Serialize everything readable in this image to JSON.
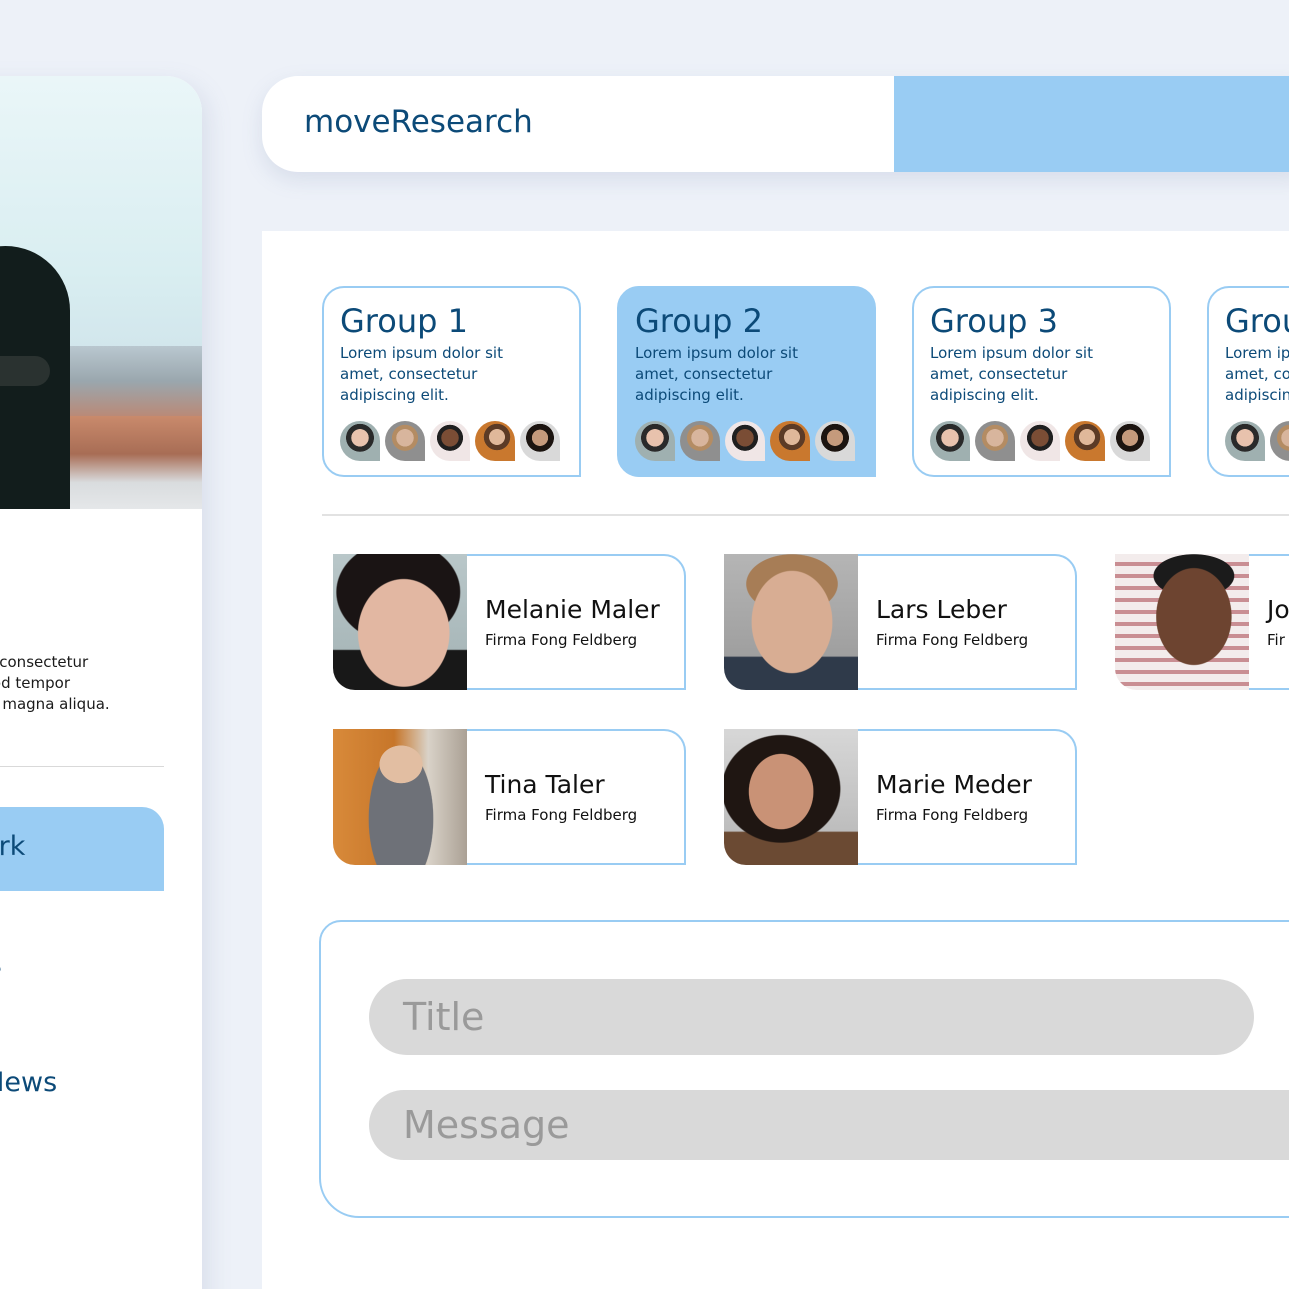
{
  "app": {
    "name": "moveResearch"
  },
  "colors": {
    "accent": "#99ccf3",
    "primary_text": "#0c4a78",
    "background": "#edf1f8"
  },
  "sidebar": {
    "description": "met, consectetur\nusmod tempor\nolore magna aliqua.\nm.",
    "nav": [
      {
        "label": "work",
        "active": true
      },
      {
        "label": "nts",
        "active": false
      },
      {
        "label": "k News",
        "active": false
      }
    ]
  },
  "groups": [
    {
      "title": "Group 1",
      "description": "Lorem ipsum dolor sit amet, consectetur adipiscing elit.",
      "active": false
    },
    {
      "title": "Group 2",
      "description": "Lorem ipsum dolor sit amet, consectetur adipiscing elit.",
      "active": true
    },
    {
      "title": "Group 3",
      "description": "Lorem ipsum dolor sit amet, consectetur adipiscing elit.",
      "active": false
    },
    {
      "title": "Grou",
      "description": "Lorem ip amet, co adipiscin",
      "active": false
    }
  ],
  "people": [
    {
      "name": "Melanie Maler",
      "company": "Firma Fong Feldberg"
    },
    {
      "name": "Lars Leber",
      "company": "Firma Fong Feldberg"
    },
    {
      "name": "Jo",
      "company": "Fir"
    },
    {
      "name": "Tina Taler",
      "company": "Firma Fong Feldberg"
    },
    {
      "name": "Marie Meder",
      "company": "Firma Fong Feldberg"
    }
  ],
  "form": {
    "title_placeholder": "Title",
    "message_placeholder": "Message"
  }
}
